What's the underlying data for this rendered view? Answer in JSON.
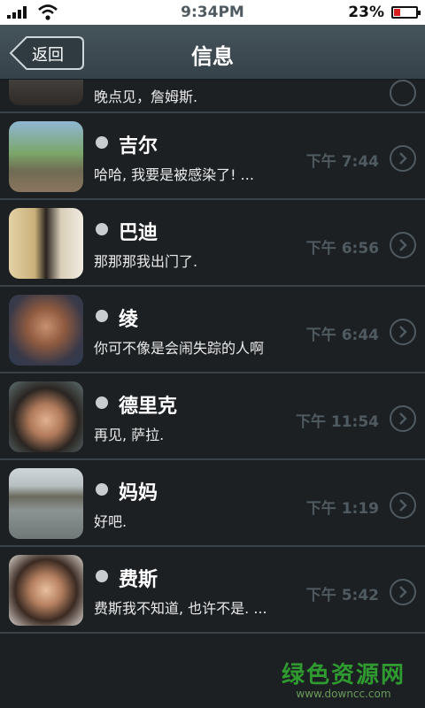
{
  "status_bar": {
    "time": "9:34PM",
    "battery": "23%"
  },
  "nav": {
    "back_label": "返回",
    "title": "信息"
  },
  "partial_row": {
    "preview": "晚点见，詹姆斯."
  },
  "messages": [
    {
      "name": "吉尔",
      "preview": "哈哈, 我要是被感染了! ...",
      "time": "下午 7:44"
    },
    {
      "name": "巴迪",
      "preview": "那那那我出门了.",
      "time": "下午 6:56"
    },
    {
      "name": "绫",
      "preview": "你可不像是会闹失踪的人啊",
      "time": "下午 6:44"
    },
    {
      "name": "德里克",
      "preview": "再见, 萨拉.",
      "time": "下午 11:54"
    },
    {
      "name": "妈妈",
      "preview": "好吧.",
      "time": "下午 1:19"
    },
    {
      "name": "费斯",
      "preview": "费斯我不知道, 也许不是. ...",
      "time": "下午 5:42"
    }
  ],
  "watermark": {
    "main": "绿色资源网",
    "sub": "www.downcc.com"
  },
  "colors": {
    "background": "#1c2023",
    "navbar": "#3e4a52",
    "divider": "#3a4248",
    "time": "#4f5a61",
    "watermark": "#2f9a2f"
  }
}
